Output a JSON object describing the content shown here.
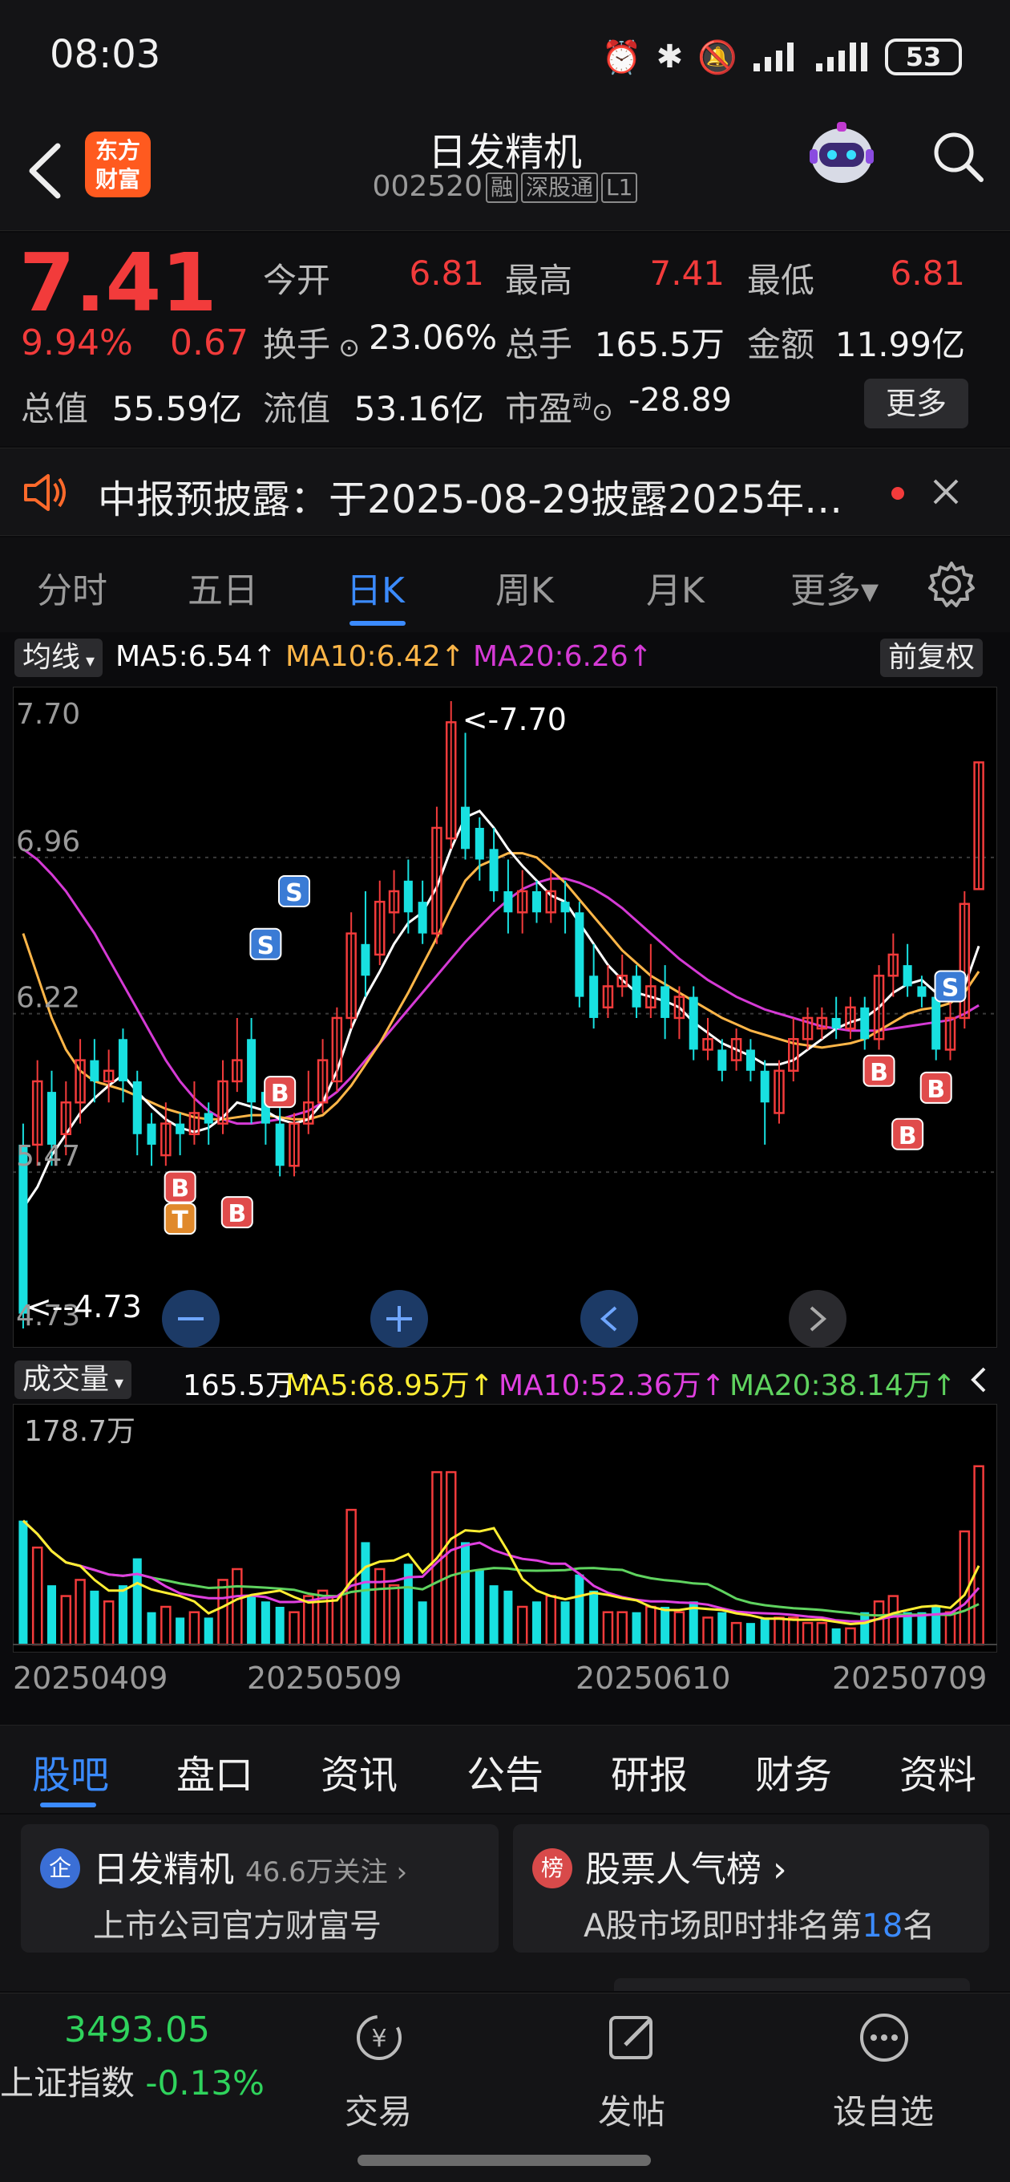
{
  "status_bar": {
    "time": "08:03",
    "battery": "53"
  },
  "header": {
    "logo_text": "东方财富",
    "title": "日发精机",
    "code": "002520",
    "tags": [
      "融",
      "深股通",
      "L1"
    ]
  },
  "quote": {
    "price": "7.41",
    "change_pct": "9.94%",
    "change": "0.67",
    "fields": [
      {
        "label": "今开",
        "value": "6.81",
        "color": "red"
      },
      {
        "label": "最高",
        "value": "7.41",
        "color": "red"
      },
      {
        "label": "最低",
        "value": "6.81",
        "color": "red"
      },
      {
        "label": "换手",
        "value": "23.06%",
        "color": "white"
      },
      {
        "label": "总手",
        "value": "165.5万",
        "color": "white"
      },
      {
        "label": "金额",
        "value": "11.99亿",
        "color": "white"
      },
      {
        "label": "总值",
        "value": "55.59亿",
        "color": "white"
      },
      {
        "label": "流值",
        "value": "53.16亿",
        "color": "white"
      },
      {
        "label": "市盈",
        "value": "-28.89",
        "color": "white"
      }
    ],
    "pe_superscript": "动",
    "more_label": "更多"
  },
  "notice": {
    "text": "中报预披露：于2025-08-29披露2025年…"
  },
  "chart_tabs": [
    "分时",
    "五日",
    "日K",
    "周K",
    "月K",
    "更多▾"
  ],
  "chart_tabs_active": 2,
  "ma_legend": {
    "pill_label": "均线",
    "ma5": "MA5:6.54↑",
    "ma10": "MA10:6.42↑",
    "ma20": "MA20:6.26↑",
    "adjust_label": "前复权"
  },
  "volume_legend": {
    "pill_label": "成交量",
    "vol": "165.5万↑",
    "ma5": "MA5:68.95万↑",
    "ma10": "MA10:52.36万↑",
    "ma20": "MA20:38.14万↑"
  },
  "chart_data": {
    "type": "candlestick",
    "ylim": [
      4.73,
      7.7
    ],
    "y_ticks": [
      "7.70",
      "6.96",
      "6.22",
      "5.47",
      "4.73"
    ],
    "high_label": "<-7.70",
    "low_label": "<--4.73",
    "volume_max_label": "178.7万",
    "volume_ylim": [
      0,
      178.7
    ],
    "x_ticks": [
      "20250409",
      "20250509",
      "20250610",
      "20250709"
    ],
    "candles": [
      {
        "o": 5.6,
        "c": 4.8,
        "h": 5.7,
        "l": 4.73,
        "v": 115
      },
      {
        "o": 5.6,
        "c": 5.9,
        "h": 6.0,
        "l": 5.5,
        "v": 90
      },
      {
        "o": 5.85,
        "c": 5.6,
        "h": 5.95,
        "l": 5.5,
        "v": 55
      },
      {
        "o": 5.65,
        "c": 5.8,
        "h": 5.9,
        "l": 5.55,
        "v": 45
      },
      {
        "o": 5.8,
        "c": 6.0,
        "h": 6.1,
        "l": 5.7,
        "v": 60
      },
      {
        "o": 6.0,
        "c": 5.9,
        "h": 6.1,
        "l": 5.8,
        "v": 50
      },
      {
        "o": 5.9,
        "c": 5.95,
        "h": 6.05,
        "l": 5.8,
        "v": 40
      },
      {
        "o": 6.1,
        "c": 5.9,
        "h": 6.15,
        "l": 5.8,
        "v": 55
      },
      {
        "o": 5.9,
        "c": 5.65,
        "h": 5.95,
        "l": 5.55,
        "v": 80
      },
      {
        "o": 5.7,
        "c": 5.6,
        "h": 5.75,
        "l": 5.5,
        "v": 30
      },
      {
        "o": 5.55,
        "c": 5.7,
        "h": 5.8,
        "l": 5.5,
        "v": 35
      },
      {
        "o": 5.7,
        "c": 5.65,
        "h": 5.75,
        "l": 5.55,
        "v": 25
      },
      {
        "o": 5.65,
        "c": 5.75,
        "h": 5.9,
        "l": 5.6,
        "v": 30
      },
      {
        "o": 5.75,
        "c": 5.7,
        "h": 5.8,
        "l": 5.6,
        "v": 25
      },
      {
        "o": 5.7,
        "c": 5.9,
        "h": 6.0,
        "l": 5.65,
        "v": 60
      },
      {
        "o": 5.9,
        "c": 6.0,
        "h": 6.2,
        "l": 5.85,
        "v": 70
      },
      {
        "o": 6.1,
        "c": 5.8,
        "h": 6.2,
        "l": 5.7,
        "v": 45
      },
      {
        "o": 5.85,
        "c": 5.7,
        "h": 5.9,
        "l": 5.6,
        "v": 40
      },
      {
        "o": 5.7,
        "c": 5.5,
        "h": 5.8,
        "l": 5.45,
        "v": 35
      },
      {
        "o": 5.5,
        "c": 5.7,
        "h": 5.75,
        "l": 5.45,
        "v": 30
      },
      {
        "o": 5.7,
        "c": 5.8,
        "h": 5.95,
        "l": 5.65,
        "v": 45
      },
      {
        "o": 5.8,
        "c": 6.0,
        "h": 6.1,
        "l": 5.75,
        "v": 50
      },
      {
        "o": 5.9,
        "c": 6.2,
        "h": 6.25,
        "l": 5.85,
        "v": 45
      },
      {
        "o": 6.2,
        "c": 6.6,
        "h": 6.7,
        "l": 6.15,
        "v": 125
      },
      {
        "o": 6.55,
        "c": 6.4,
        "h": 6.8,
        "l": 6.3,
        "v": 95
      },
      {
        "o": 6.5,
        "c": 6.75,
        "h": 6.85,
        "l": 6.45,
        "v": 70
      },
      {
        "o": 6.7,
        "c": 6.8,
        "h": 6.9,
        "l": 6.6,
        "v": 55
      },
      {
        "o": 6.85,
        "c": 6.7,
        "h": 6.95,
        "l": 6.6,
        "v": 75
      },
      {
        "o": 6.75,
        "c": 6.6,
        "h": 6.85,
        "l": 6.55,
        "v": 40
      },
      {
        "o": 6.6,
        "c": 7.1,
        "h": 7.2,
        "l": 6.55,
        "v": 160
      },
      {
        "o": 7.05,
        "c": 7.6,
        "h": 7.7,
        "l": 7.0,
        "v": 160
      },
      {
        "o": 7.2,
        "c": 7.0,
        "h": 7.55,
        "l": 6.95,
        "v": 95
      },
      {
        "o": 7.1,
        "c": 6.95,
        "h": 7.15,
        "l": 6.85,
        "v": 70
      },
      {
        "o": 7.0,
        "c": 6.8,
        "h": 7.1,
        "l": 6.75,
        "v": 55
      },
      {
        "o": 6.8,
        "c": 6.7,
        "h": 6.95,
        "l": 6.6,
        "v": 50
      },
      {
        "o": 6.7,
        "c": 6.8,
        "h": 6.9,
        "l": 6.6,
        "v": 35
      },
      {
        "o": 6.8,
        "c": 6.7,
        "h": 6.85,
        "l": 6.65,
        "v": 40
      },
      {
        "o": 6.7,
        "c": 6.8,
        "h": 6.9,
        "l": 6.65,
        "v": 45
      },
      {
        "o": 6.75,
        "c": 6.7,
        "h": 6.85,
        "l": 6.6,
        "v": 40
      },
      {
        "o": 6.7,
        "c": 6.3,
        "h": 6.75,
        "l": 6.25,
        "v": 65
      },
      {
        "o": 6.4,
        "c": 6.2,
        "h": 6.55,
        "l": 6.15,
        "v": 50
      },
      {
        "o": 6.25,
        "c": 6.35,
        "h": 6.45,
        "l": 6.2,
        "v": 30
      },
      {
        "o": 6.35,
        "c": 6.4,
        "h": 6.5,
        "l": 6.3,
        "v": 30
      },
      {
        "o": 6.4,
        "c": 6.25,
        "h": 6.45,
        "l": 6.2,
        "v": 30
      },
      {
        "o": 6.25,
        "c": 6.35,
        "h": 6.55,
        "l": 6.2,
        "v": 35
      },
      {
        "o": 6.35,
        "c": 6.2,
        "h": 6.45,
        "l": 6.1,
        "v": 35
      },
      {
        "o": 6.2,
        "c": 6.3,
        "h": 6.35,
        "l": 6.1,
        "v": 30
      },
      {
        "o": 6.3,
        "c": 6.05,
        "h": 6.35,
        "l": 6.0,
        "v": 40
      },
      {
        "o": 6.05,
        "c": 6.1,
        "h": 6.2,
        "l": 6.0,
        "v": 25
      },
      {
        "o": 6.05,
        "c": 5.95,
        "h": 6.1,
        "l": 5.9,
        "v": 30
      },
      {
        "o": 6.0,
        "c": 6.1,
        "h": 6.15,
        "l": 5.95,
        "v": 20
      },
      {
        "o": 6.05,
        "c": 5.95,
        "h": 6.1,
        "l": 5.9,
        "v": 20
      },
      {
        "o": 5.95,
        "c": 5.8,
        "h": 6.0,
        "l": 5.6,
        "v": 25
      },
      {
        "o": 5.75,
        "c": 5.95,
        "h": 6.0,
        "l": 5.7,
        "v": 25
      },
      {
        "o": 5.95,
        "c": 6.1,
        "h": 6.2,
        "l": 5.9,
        "v": 25
      },
      {
        "o": 6.1,
        "c": 6.2,
        "h": 6.25,
        "l": 6.05,
        "v": 20
      },
      {
        "o": 6.15,
        "c": 6.2,
        "h": 6.25,
        "l": 6.1,
        "v": 20
      },
      {
        "o": 6.2,
        "c": 6.15,
        "h": 6.3,
        "l": 6.1,
        "v": 15
      },
      {
        "o": 6.15,
        "c": 6.25,
        "h": 6.3,
        "l": 6.1,
        "v": 15
      },
      {
        "o": 6.25,
        "c": 6.1,
        "h": 6.3,
        "l": 6.05,
        "v": 30
      },
      {
        "o": 6.1,
        "c": 6.4,
        "h": 6.45,
        "l": 6.05,
        "v": 40
      },
      {
        "o": 6.4,
        "c": 6.5,
        "h": 6.6,
        "l": 6.3,
        "v": 45
      },
      {
        "o": 6.45,
        "c": 6.35,
        "h": 6.55,
        "l": 6.3,
        "v": 30
      },
      {
        "o": 6.35,
        "c": 6.3,
        "h": 6.4,
        "l": 6.25,
        "v": 30
      },
      {
        "o": 6.3,
        "c": 6.05,
        "h": 6.35,
        "l": 6.0,
        "v": 35
      },
      {
        "o": 6.05,
        "c": 6.2,
        "h": 6.3,
        "l": 6.0,
        "v": 30
      },
      {
        "o": 6.2,
        "c": 6.74,
        "h": 6.8,
        "l": 6.15,
        "v": 105
      },
      {
        "o": 6.81,
        "c": 7.41,
        "h": 7.41,
        "l": 6.81,
        "v": 165.5
      }
    ],
    "ma5": [
      5.3,
      5.4,
      5.55,
      5.65,
      5.75,
      5.82,
      5.88,
      5.93,
      5.85,
      5.78,
      5.72,
      5.68,
      5.66,
      5.68,
      5.73,
      5.8,
      5.78,
      5.76,
      5.72,
      5.7,
      5.72,
      5.8,
      5.95,
      6.15,
      6.3,
      6.42,
      6.55,
      6.65,
      6.7,
      6.82,
      7.0,
      7.15,
      7.18,
      7.1,
      7.0,
      6.92,
      6.85,
      6.78,
      6.75,
      6.65,
      6.55,
      6.45,
      6.38,
      6.32,
      6.3,
      6.28,
      6.25,
      6.18,
      6.13,
      6.08,
      6.05,
      6.02,
      5.98,
      5.98,
      6.0,
      6.05,
      6.1,
      6.15,
      6.18,
      6.2,
      6.25,
      6.32,
      6.36,
      6.38,
      6.32,
      6.28,
      6.35,
      6.54
    ],
    "ma10": [
      6.6,
      6.4,
      6.2,
      6.05,
      5.95,
      5.9,
      5.88,
      5.86,
      5.83,
      5.8,
      5.77,
      5.75,
      5.73,
      5.72,
      5.72,
      5.73,
      5.74,
      5.74,
      5.73,
      5.72,
      5.72,
      5.74,
      5.8,
      5.88,
      5.98,
      6.08,
      6.2,
      6.32,
      6.45,
      6.58,
      6.72,
      6.85,
      6.92,
      6.95,
      6.98,
      6.98,
      6.96,
      6.9,
      6.84,
      6.76,
      6.68,
      6.6,
      6.52,
      6.46,
      6.4,
      6.36,
      6.32,
      6.28,
      6.24,
      6.2,
      6.17,
      6.14,
      6.12,
      6.1,
      6.08,
      6.07,
      6.06,
      6.07,
      6.08,
      6.1,
      6.14,
      6.18,
      6.22,
      6.24,
      6.25,
      6.27,
      6.32,
      6.42
    ],
    "ma20": [
      7.0,
      6.95,
      6.88,
      6.8,
      6.7,
      6.6,
      6.48,
      6.36,
      6.24,
      6.12,
      6.0,
      5.9,
      5.82,
      5.76,
      5.72,
      5.7,
      5.7,
      5.71,
      5.72,
      5.74,
      5.76,
      5.8,
      5.85,
      5.92,
      6.0,
      6.08,
      6.16,
      6.24,
      6.32,
      6.4,
      6.48,
      6.56,
      6.63,
      6.7,
      6.76,
      6.81,
      6.84,
      6.86,
      6.86,
      6.84,
      6.81,
      6.77,
      6.72,
      6.66,
      6.6,
      6.54,
      6.48,
      6.43,
      6.38,
      6.34,
      6.3,
      6.27,
      6.24,
      6.22,
      6.2,
      6.18,
      6.16,
      6.15,
      6.14,
      6.14,
      6.14,
      6.15,
      6.16,
      6.17,
      6.18,
      6.19,
      6.22,
      6.26
    ],
    "markers": [
      {
        "i": 11,
        "label": "B",
        "color": "#e04b4b",
        "pos": "below",
        "y": 5.4
      },
      {
        "i": 11,
        "label": "T",
        "color": "#e0892b",
        "pos": "below",
        "y": 5.25
      },
      {
        "i": 15,
        "label": "B",
        "color": "#e04b4b",
        "pos": "below",
        "y": 5.28
      },
      {
        "i": 18,
        "label": "B",
        "color": "#e04b4b",
        "pos": "mid",
        "y": 5.85
      },
      {
        "i": 17,
        "label": "S",
        "color": "#3a7bd5",
        "pos": "above",
        "y": 6.55
      },
      {
        "i": 19,
        "label": "S",
        "color": "#3a7bd5",
        "pos": "above",
        "y": 6.8
      },
      {
        "i": 60,
        "label": "B",
        "color": "#e04b4b",
        "pos": "below",
        "y": 5.95
      },
      {
        "i": 62,
        "label": "B",
        "color": "#e04b4b",
        "pos": "below",
        "y": 5.65
      },
      {
        "i": 64,
        "label": "B",
        "color": "#e04b4b",
        "pos": "below",
        "y": 5.87
      },
      {
        "i": 65,
        "label": "S",
        "color": "#3a7bd5",
        "pos": "mid",
        "y": 6.35
      }
    ]
  },
  "chart_controls": [
    "zoom-out",
    "zoom-in",
    "scroll-left",
    "scroll-right"
  ],
  "info_tabs": [
    "股吧",
    "盘口",
    "资讯",
    "公告",
    "研报",
    "财务",
    "资料"
  ],
  "info_tabs_active": 0,
  "cards": [
    {
      "icon": "企",
      "title": "日发精机",
      "title_suffix": "46.6万关注 ›",
      "sub": "上市公司官方财富号",
      "icon_color": "#3b6fd6"
    },
    {
      "icon": "榜",
      "title": "股票人气榜 ›",
      "sub_prefix": "A股市场即时排名第",
      "rank": "18",
      "sub_suffix": "名",
      "icon_color": "#d84a4a"
    }
  ],
  "bottom_nav": {
    "index_value": "3493.05",
    "index_name": "上证指数",
    "index_change": "-0.13%",
    "buttons": [
      "交易",
      "发帖",
      "设自选"
    ]
  },
  "colors": {
    "up": "#f23b3b",
    "down": "#18e0e0",
    "accent": "#3b8bff",
    "ma5": "#ffffff",
    "ma10": "#ffb648",
    "ma20": "#d53ad5",
    "vma5": "#ffee33",
    "vma10": "#e040e0",
    "vma20": "#5fd35f"
  }
}
